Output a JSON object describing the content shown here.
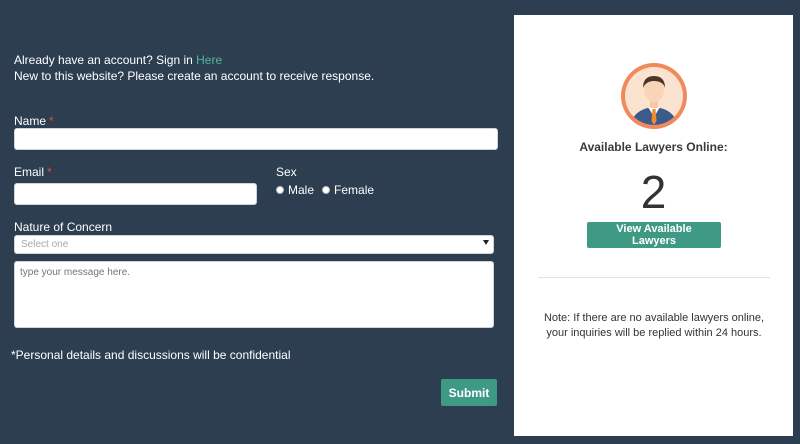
{
  "intro": {
    "signin_text": "Already have an account? Sign in ",
    "signin_link": "Here",
    "new_text": "New to this website? Please create an account to receive response."
  },
  "form": {
    "name_label": "Name",
    "email_label": "Email",
    "required_mark": "*",
    "sex_label": "Sex",
    "sex_options": [
      "Male",
      "Female"
    ],
    "concern_label": "Nature of Concern",
    "concern_placeholder": "Select one",
    "message_placeholder": "type your message here.",
    "confidential_note": "*Personal details and discussions will be confidential",
    "submit_label": "Submit"
  },
  "panel": {
    "title": "Available Lawyers Online:",
    "count": "2",
    "view_button": "View Available Lawyers",
    "note": "Note: If there are no available lawyers online, your inquiries will be replied within 24 hours."
  },
  "colors": {
    "background": "#2c3e50",
    "accent": "#3f9a85",
    "link": "#4fb89f",
    "required": "#e04a4a"
  },
  "icons": {
    "avatar": "lawyer-avatar-icon",
    "select_caret": "caret-down-icon"
  }
}
